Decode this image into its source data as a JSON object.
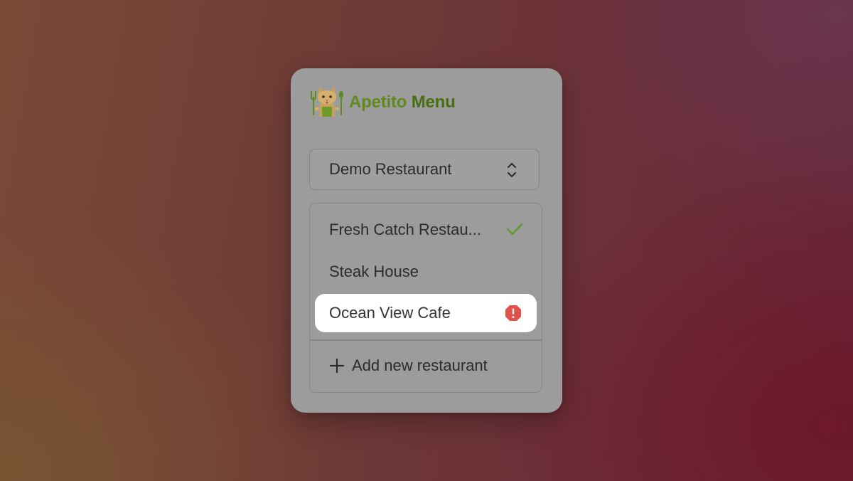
{
  "brand": {
    "name_part1": "Apetito",
    "name_part2": "Menu",
    "logo_icon": "cat-chef-icon",
    "color_part1": "#5f8a1e",
    "color_part2": "#466f12"
  },
  "restaurant_selector": {
    "selected": "Demo Restaurant",
    "icon": "chevron-up-down-icon"
  },
  "restaurant_list": {
    "items": [
      {
        "label": "Fresh Catch Restau...",
        "status": "selected",
        "status_icon": "checkmark-icon",
        "status_color": "#5f9a2a"
      },
      {
        "label": "Steak House",
        "status": "none"
      },
      {
        "label": "Ocean View Cafe",
        "status": "error",
        "status_icon": "alert-icon",
        "status_color": "#e0514a",
        "highlighted": true
      }
    ],
    "add_label": "Add new restaurant",
    "add_icon": "plus-icon"
  }
}
